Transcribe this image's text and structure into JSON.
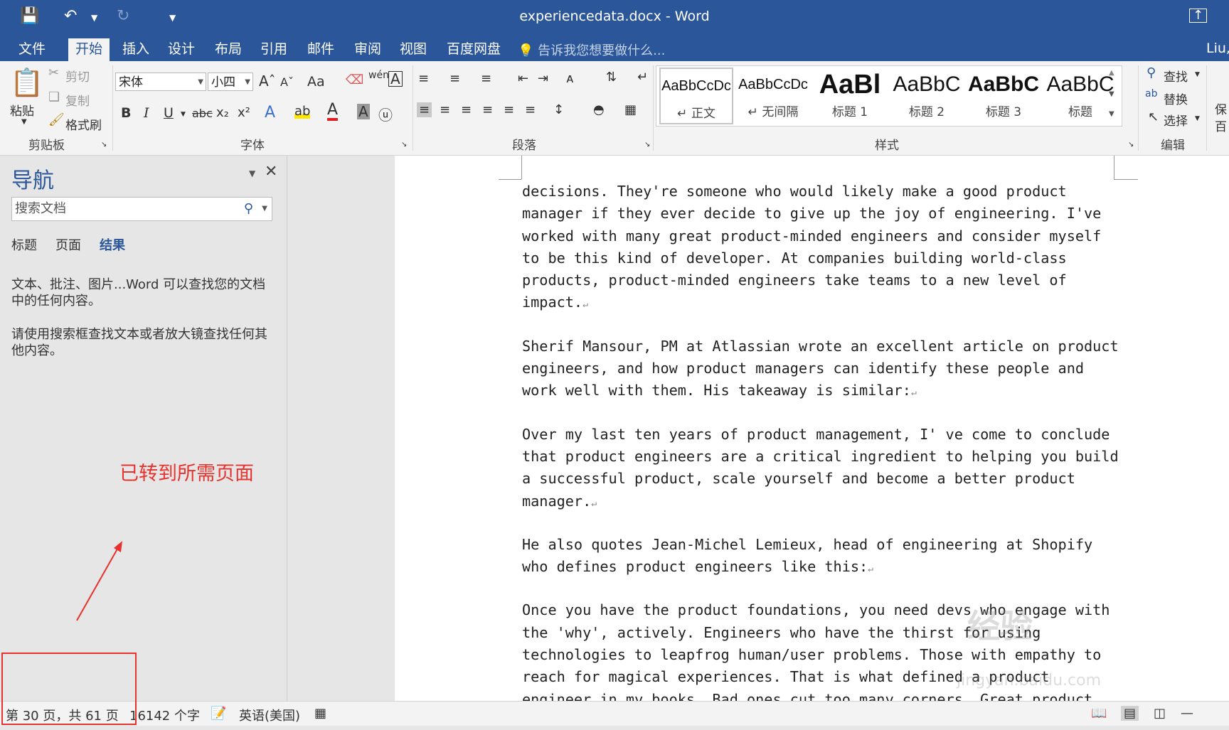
{
  "window": {
    "title": "experiencedata.docx - Word"
  },
  "quick_access": {
    "save_icon": "save-icon",
    "undo_icon": "undo-icon",
    "redo_icon": "redo-icon",
    "customize_icon": "customize-icon",
    "restore_icon": "restore-icon"
  },
  "tabs": [
    {
      "label": "文件"
    },
    {
      "label": "开始"
    },
    {
      "label": "插入"
    },
    {
      "label": "设计"
    },
    {
      "label": "布局"
    },
    {
      "label": "引用"
    },
    {
      "label": "邮件"
    },
    {
      "label": "审阅"
    },
    {
      "label": "视图"
    },
    {
      "label": "百度网盘"
    }
  ],
  "tell_me": "告诉我您想要做什么...",
  "user": "Liu,",
  "ribbon": {
    "clipboard": {
      "paste": "粘贴",
      "cut": "剪切",
      "copy": "复制",
      "format_painter": "格式刷",
      "label": "剪贴板"
    },
    "font": {
      "name": "宋体",
      "size": "小四",
      "case": "Aa",
      "label": "字体",
      "bold": "B",
      "italic": "I",
      "underline": "U",
      "strike": "abc"
    },
    "paragraph": {
      "label": "段落"
    },
    "styles": {
      "items": [
        {
          "sample": "AaBbCcDc",
          "name": "正文"
        },
        {
          "sample": "AaBbCcDc",
          "name": "无间隔"
        },
        {
          "sample": "AaBl",
          "name": "标题 1"
        },
        {
          "sample": "AaBbC",
          "name": "标题 2"
        },
        {
          "sample": "AaBbC",
          "name": "标题 3"
        },
        {
          "sample": "AaBbC",
          "name": "标题"
        }
      ],
      "label": "样式"
    },
    "editing": {
      "find": "查找",
      "replace": "替换",
      "select": "选择",
      "label": "编辑"
    },
    "extra": {
      "save": "保",
      "baidu": "百"
    }
  },
  "nav": {
    "title": "导航",
    "search_placeholder": "搜索文档",
    "tabs": [
      "标题",
      "页面",
      "结果"
    ],
    "msg1": "文本、批注、图片...Word 可以查找您的文档中的任何内容。",
    "msg2": "请使用搜索框查找文本或者放大镜查找任何其他内容。"
  },
  "annotation": "已转到所需页面",
  "document": {
    "paragraphs": [
      "decisions. They're someone who would likely make a good product manager if they ever decide to give up the joy of engineering. I've worked with many great product-minded engineers and consider myself to be this kind of developer. At companies building world-class products, product-minded engineers take teams to a new level of impact.",
      "Sherif Mansour, PM at Atlassian wrote an excellent article on product engineers, and how product managers can identify these people and work well with them. His takeaway is similar:",
      "Over my last ten years of product management, I' ve come to conclude that product engineers are a critical ingredient to helping you build a successful product, scale yourself and become a better product manager.",
      "He also quotes Jean-Michel Lemieux, head of engineering at Shopify who defines product engineers like this:",
      "Once you have the product foundations, you need devs who engage with the 'why', actively. Engineers who have the thirst for using technologies to leapfrog human/user problems. Those with empathy to reach for magical experiences. That is what defined a product engineer in my books. Bad ones cut too many corners. Great product"
    ]
  },
  "status": {
    "page": "第 30 页，共 61 页",
    "words": "16142 个字",
    "language": "英语(美国)"
  },
  "watermark": {
    "main": "经验",
    "sub": "jingyan.baidu.com"
  }
}
